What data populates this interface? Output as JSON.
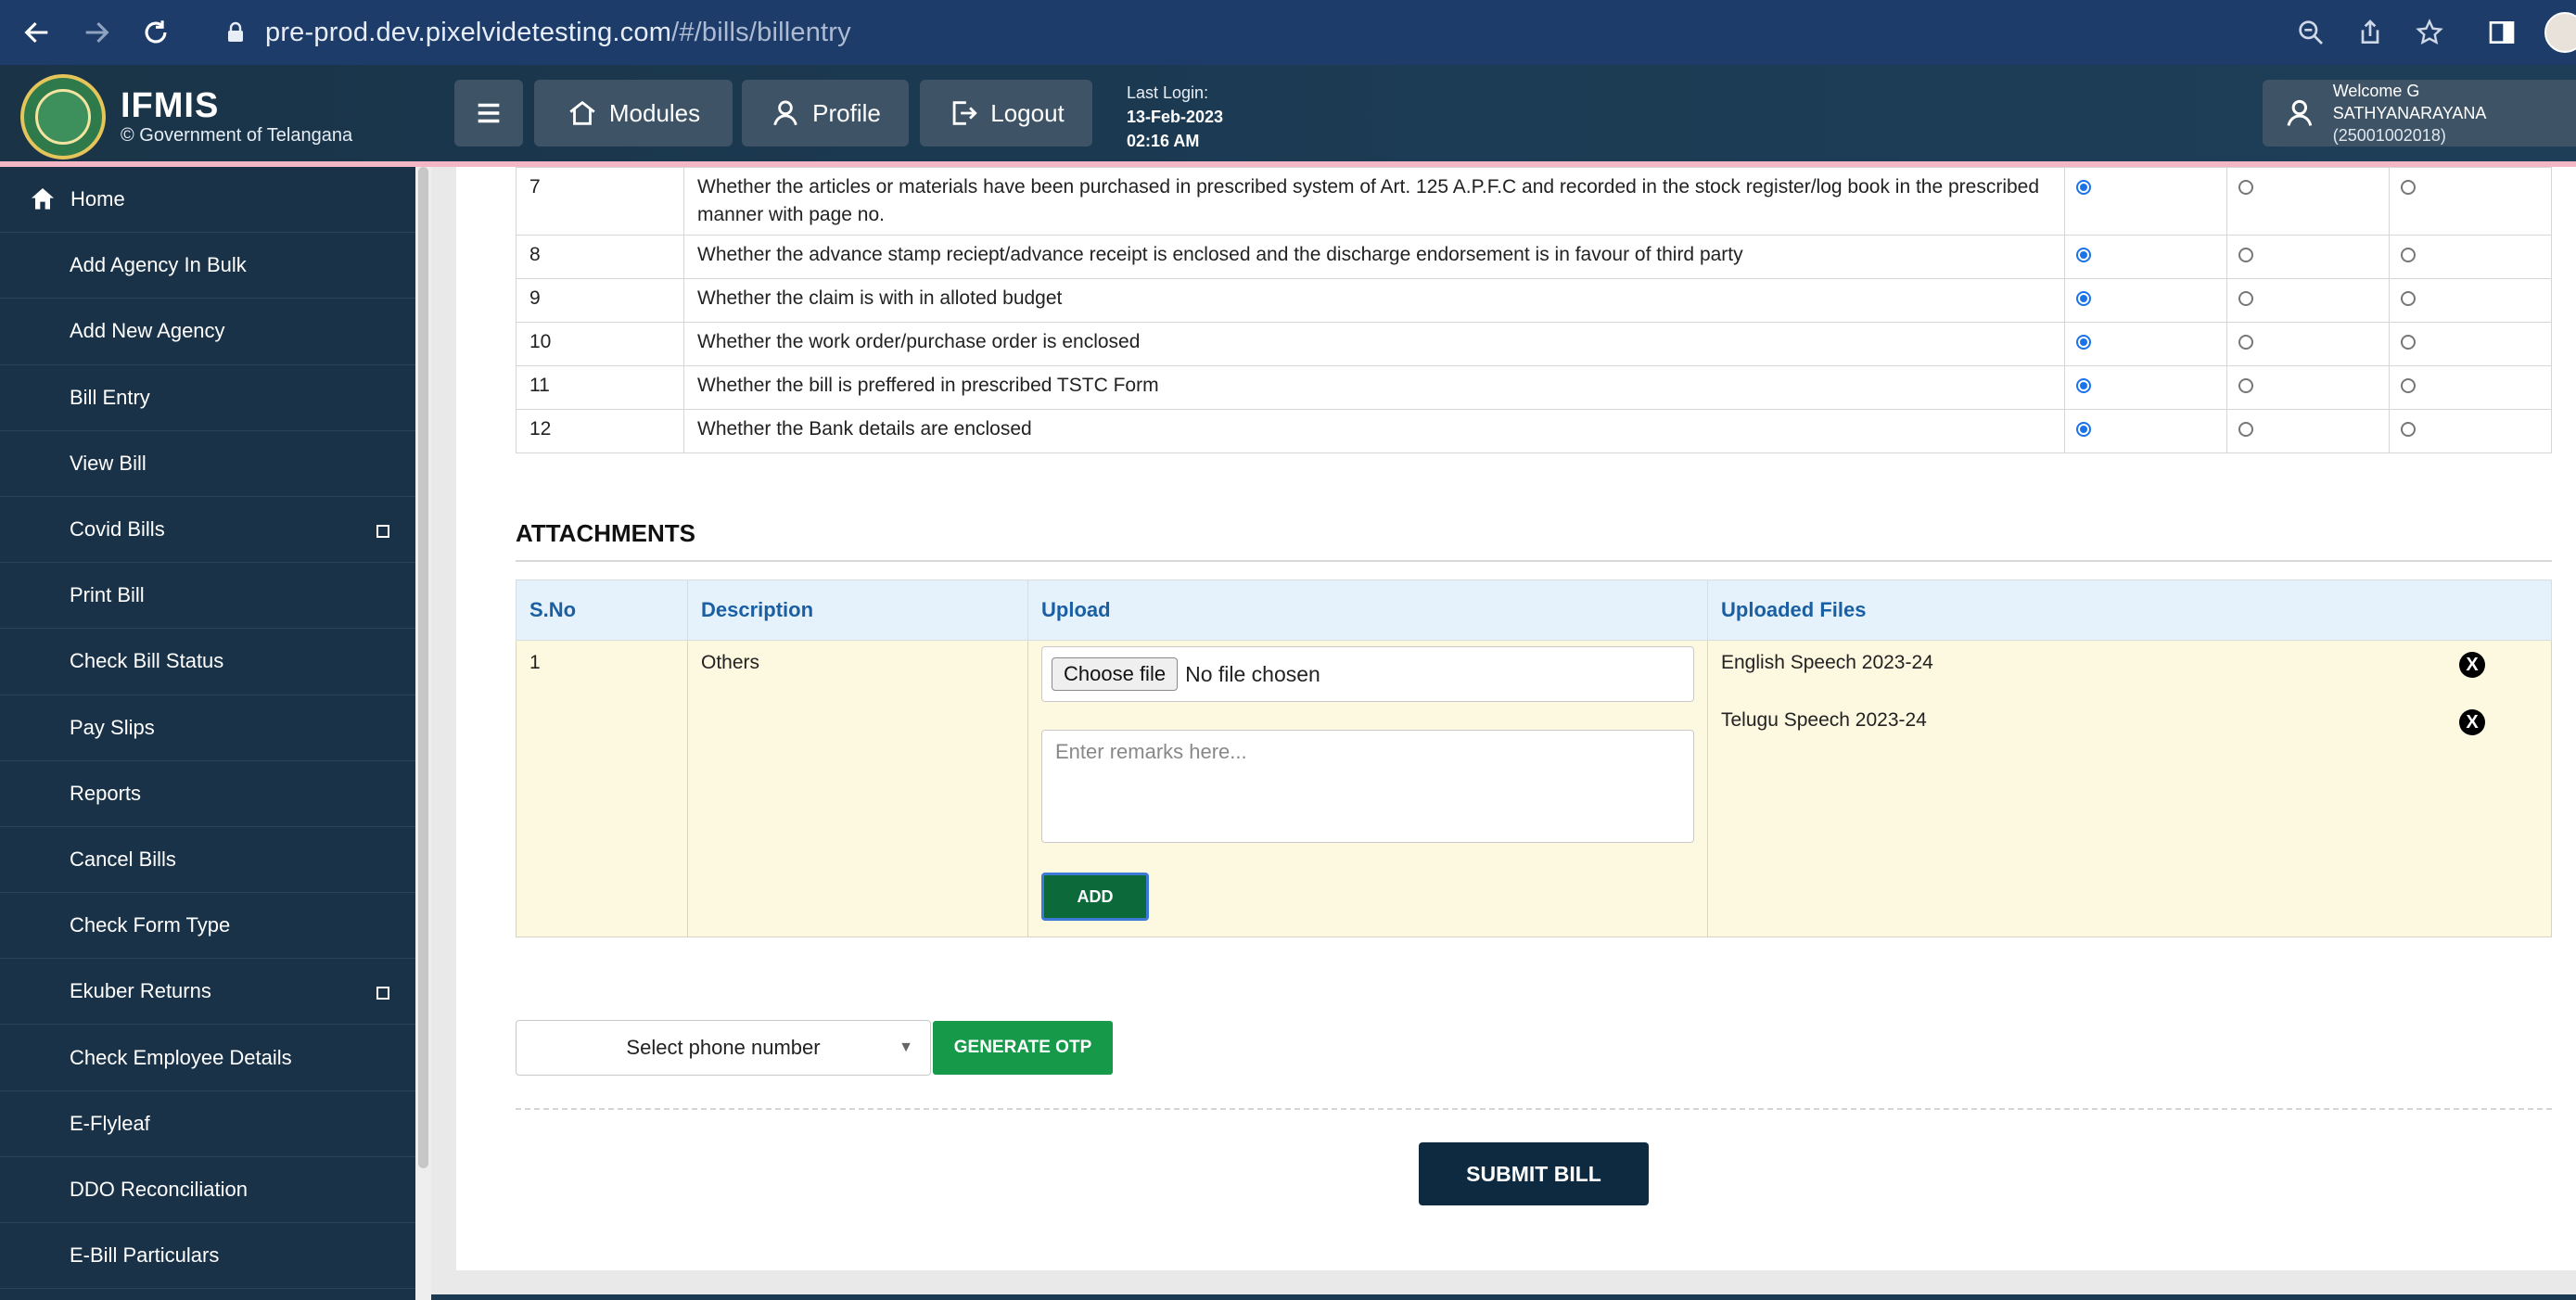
{
  "browser": {
    "url_main": "pre-prod.dev.pixelvidetesting.com",
    "url_path": "/#/bills/billentry"
  },
  "header": {
    "brand": "IFMIS",
    "subtitle": "© Government of Telangana",
    "modules_label": "Modules",
    "profile_label": "Profile",
    "logout_label": "Logout",
    "last_login_label": "Last Login:",
    "last_login_date": "13-Feb-2023",
    "last_login_time": "02:16 AM",
    "welcome_text": "Welcome G SATHYANARAYANA",
    "user_id": "(25001002018)"
  },
  "sidebar": {
    "items": [
      {
        "label": "Home"
      },
      {
        "label": "Add Agency In Bulk"
      },
      {
        "label": "Add New Agency"
      },
      {
        "label": "Bill Entry"
      },
      {
        "label": "View Bill"
      },
      {
        "label": "Covid Bills"
      },
      {
        "label": "Print Bill"
      },
      {
        "label": "Check Bill Status"
      },
      {
        "label": "Pay Slips"
      },
      {
        "label": "Reports"
      },
      {
        "label": "Cancel Bills"
      },
      {
        "label": "Check Form Type"
      },
      {
        "label": "Ekuber Returns"
      },
      {
        "label": "Check Employee Details"
      },
      {
        "label": "E-Flyleaf"
      },
      {
        "label": "DDO Reconciliation"
      },
      {
        "label": "E-Bill Particulars"
      }
    ]
  },
  "checklist": {
    "rows": [
      {
        "no": "7",
        "text": "Whether the articles or materials have been purchased in prescribed system of Art. 125 A.P.F.C and recorded in the stock register/log book in the prescribed manner with page no.",
        "selected": 0
      },
      {
        "no": "8",
        "text": "Whether the advance stamp reciept/advance receipt is enclosed and the discharge endorsement is in favour of third party",
        "selected": 0
      },
      {
        "no": "9",
        "text": "Whether the claim is with in alloted budget",
        "selected": 0
      },
      {
        "no": "10",
        "text": "Whether the work order/purchase order is enclosed",
        "selected": 0
      },
      {
        "no": "11",
        "text": "Whether the bill is preffered in prescribed TSTC Form",
        "selected": 0
      },
      {
        "no": "12",
        "text": "Whether the Bank details are enclosed",
        "selected": 0
      }
    ]
  },
  "attachments": {
    "title": "ATTACHMENTS",
    "columns": [
      "S.No",
      "Description",
      "Upload",
      "Uploaded Files"
    ],
    "row": {
      "sno": "1",
      "description": "Others",
      "choose_file_label": "Choose file",
      "no_file_text": "No file chosen",
      "remarks_placeholder": "Enter remarks here...",
      "add_label": "ADD",
      "files": [
        "English Speech 2023-24",
        "Telugu Speech 2023-24"
      ],
      "remove_glyph": "X"
    }
  },
  "otp": {
    "phone_placeholder": "Select phone number",
    "generate_label": "GENERATE OTP"
  },
  "submit_label": "SUBMIT BILL"
}
